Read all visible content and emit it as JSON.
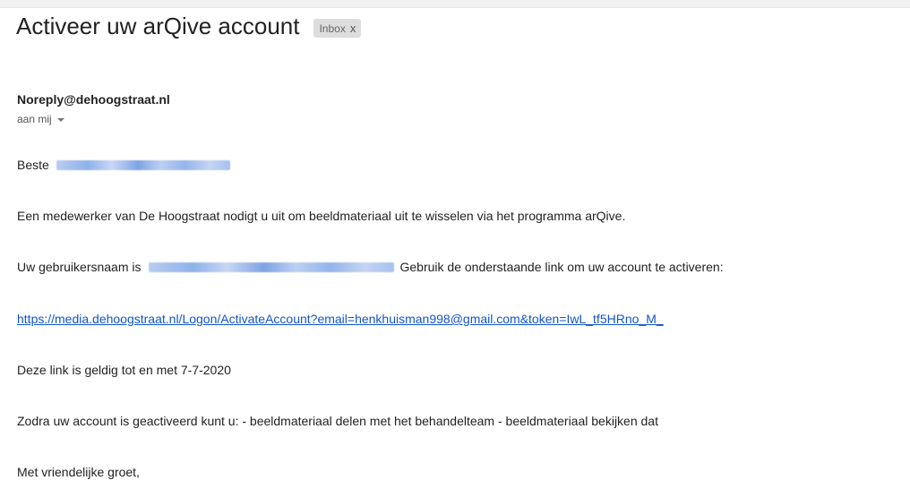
{
  "email": {
    "subject": "Activeer uw arQive account",
    "label": {
      "name": "Inbox",
      "remove_glyph": "x"
    },
    "sender": "Noreply@dehoogstraat.nl",
    "recipient": "aan mij"
  },
  "body": {
    "greeting": "Beste",
    "intro": "Een medewerker van De Hoogstraat nodigt u uit om beeldmateriaal uit te wisselen via het programma arQive.",
    "username_prefix": "Uw gebruikersnaam is",
    "username_suffix": "Gebruik de onderstaande link om uw account te activeren:",
    "activation_link": "https://media.dehoogstraat.nl/Logon/ActivateAccount?email=henkhuisman998@gmail.com&token=IwL_tf5HRno_M_",
    "validity": "Deze link is geldig tot en met 7-7-2020",
    "features": "Zodra uw account is geactiveerd kunt u: - beeldmateriaal delen met het behandelteam - beeldmateriaal bekijken dat",
    "closing": "Met vriendelijke groet,"
  },
  "colors": {
    "link": "#1155cc",
    "chip_bg": "#dddddd",
    "redaction": "#8fb2ea"
  }
}
